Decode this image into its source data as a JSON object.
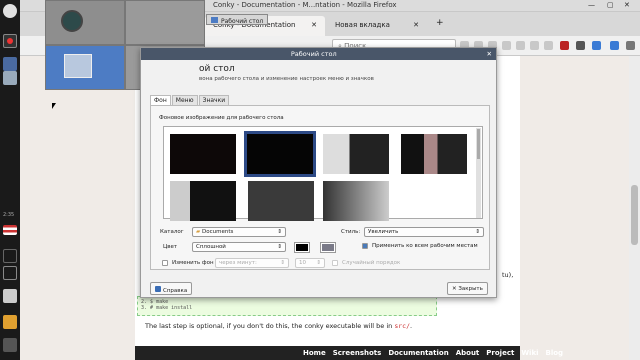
{
  "firefox": {
    "window_title": "Conky - Documentation - M...ntation - Mozilla Firefox",
    "tabs": [
      {
        "label": "Conky - Documentation"
      },
      {
        "label": "Новая вкладка"
      }
    ],
    "new_tab": "+",
    "search_placeholder": "Поиск"
  },
  "tooltip": "Рабочий стол",
  "dialog": {
    "title": "Рабочий стол",
    "heading": "ой стол",
    "subheading": "вона рабочего стола и изменение настроек меню и значков",
    "tabs": [
      {
        "label": "Фон"
      },
      {
        "label": "Меню"
      },
      {
        "label": "Значки"
      }
    ],
    "group_label": "Фоновое изображение для рабочего стола",
    "catalog_label": "Каталог",
    "catalog_value": "Documents",
    "style_label": "Стиль:",
    "style_value": "Увеличить",
    "color_label": "Цвет",
    "color_value": "Сплошной",
    "apply_all_label": "Применить ко всем рабочим местам",
    "change_label": "Изменить фон",
    "interval_value": "через минут:",
    "interval_number": "10",
    "random_label": "Случайный порядок",
    "help_label": "Справка",
    "close_label": "Закрыть",
    "colors": {
      "title_bg": "#495669",
      "selection": "#2d4a86"
    }
  },
  "page": {
    "code_lines": [
      "$ make",
      "# make install"
    ],
    "code_line_nums": [
      "2.",
      "3."
    ],
    "last_step": "The last step is optional, if you don't do this, the conky executable will be in ",
    "last_step_code": "src/",
    "fragment": "tu),",
    "footer": [
      "Home",
      "Screenshots",
      "Documentation",
      "About",
      "Project",
      "Wiki",
      "Blog"
    ]
  },
  "panel": {
    "clock": "2:35"
  }
}
